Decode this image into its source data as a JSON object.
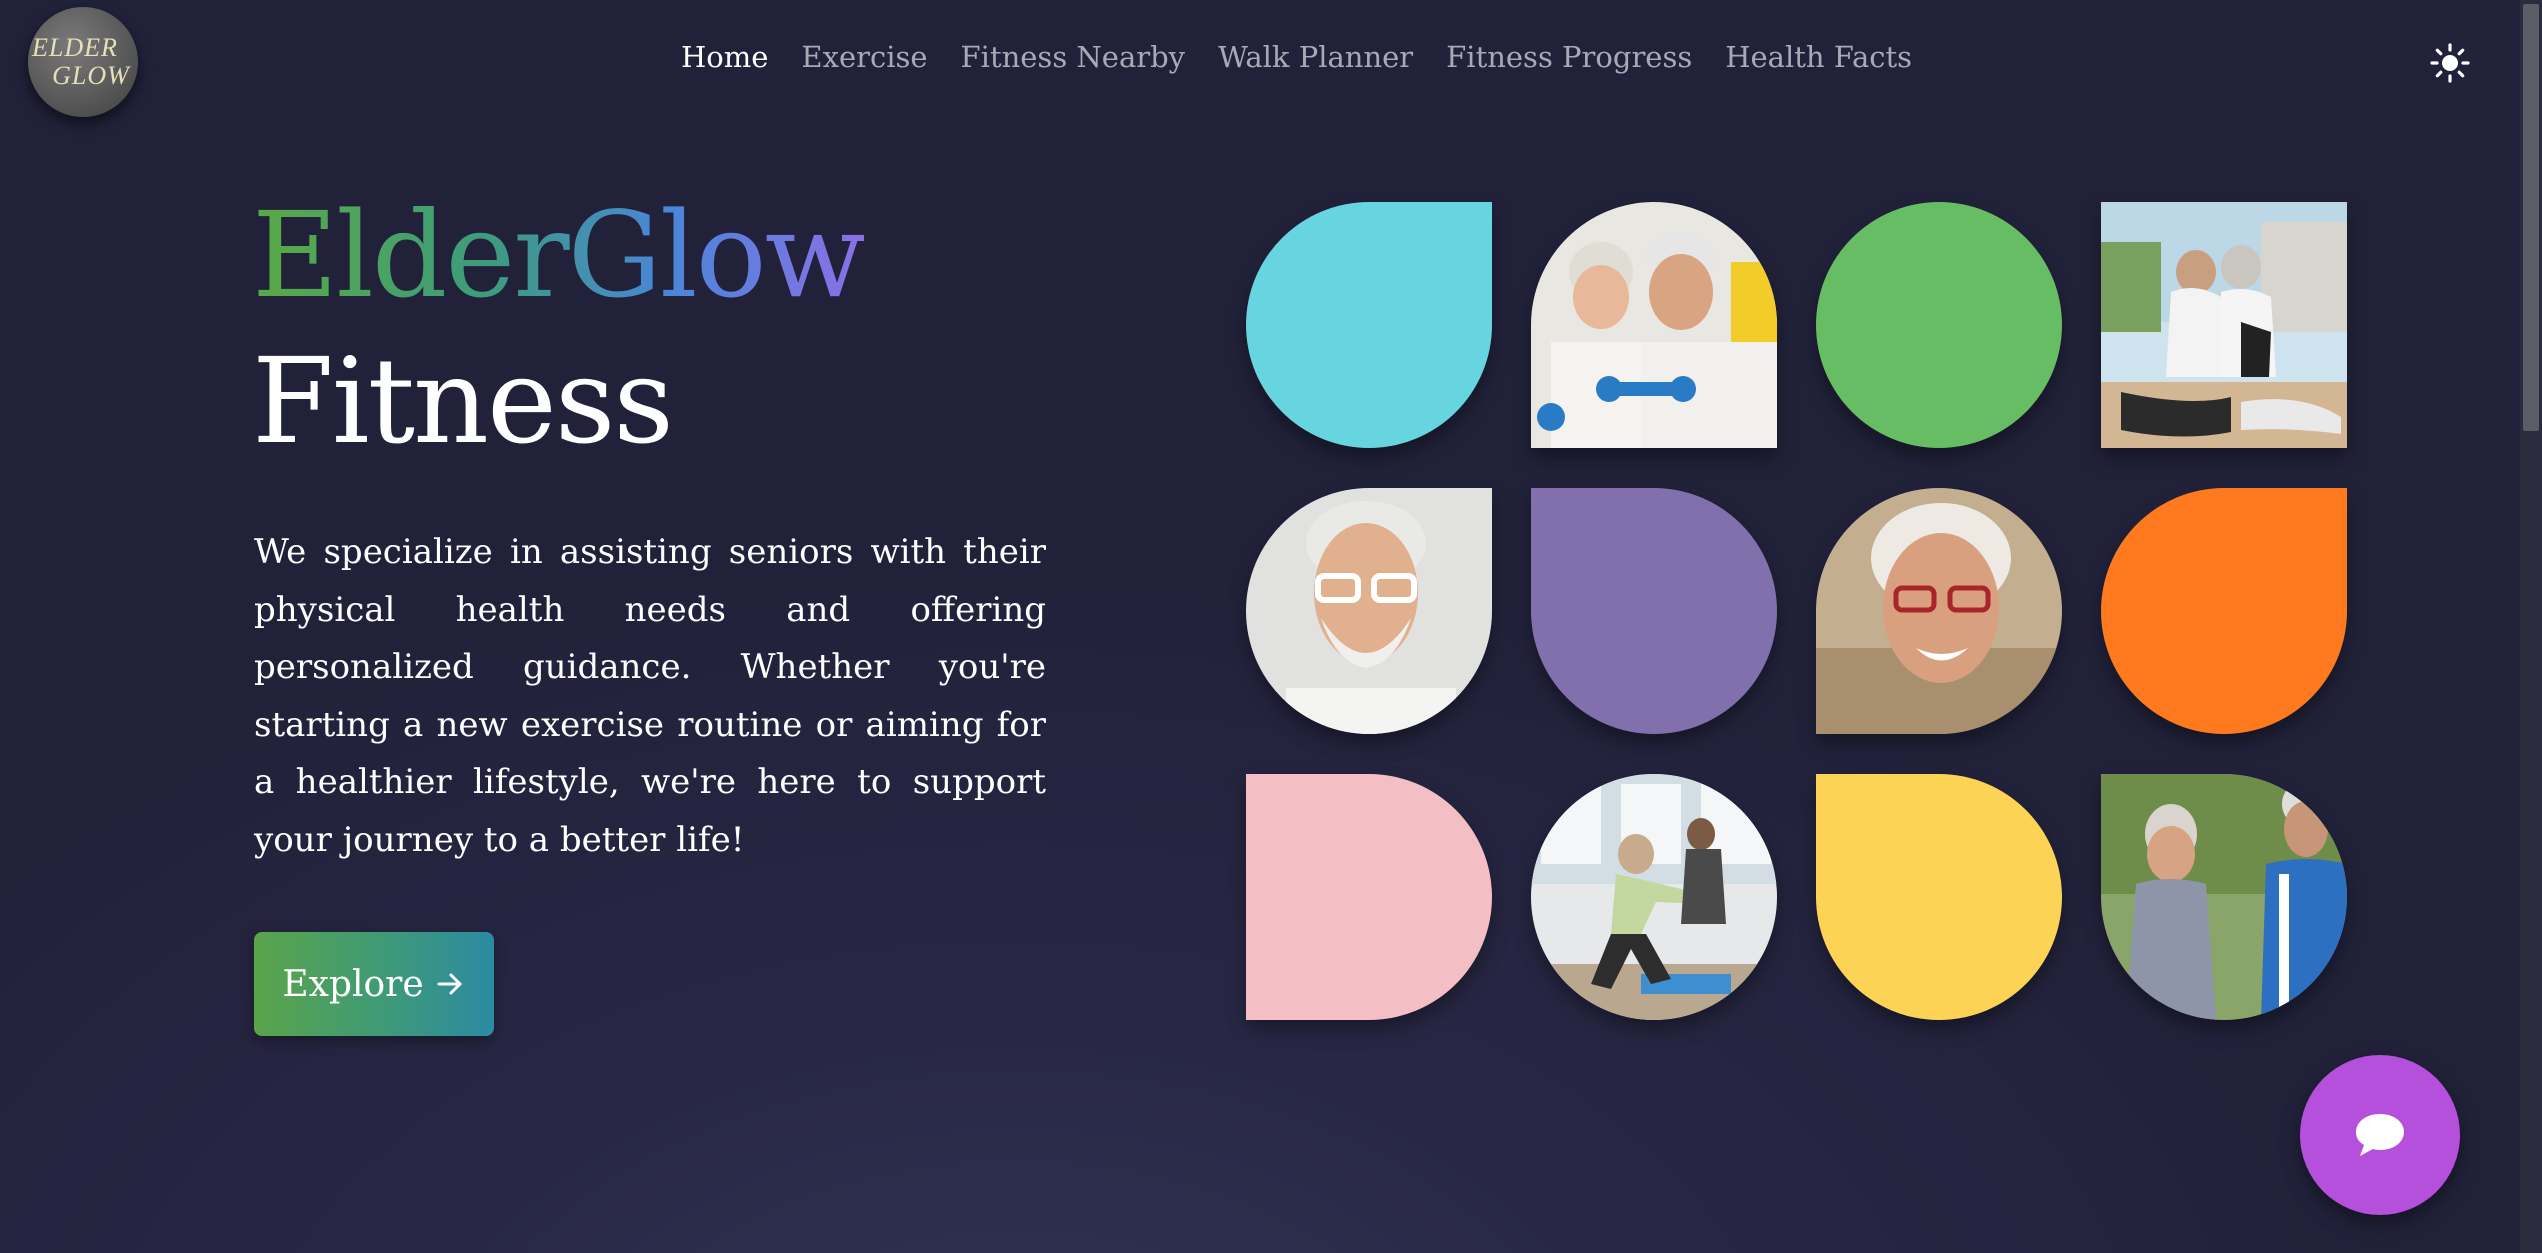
{
  "logo": {
    "line1": "ELDER",
    "line2": "GLOW"
  },
  "nav": {
    "items": [
      {
        "label": "Home",
        "active": true
      },
      {
        "label": "Exercise",
        "active": false
      },
      {
        "label": "Fitness Nearby",
        "active": false
      },
      {
        "label": "Walk Planner",
        "active": false
      },
      {
        "label": "Fitness Progress",
        "active": false
      },
      {
        "label": "Health Facts",
        "active": false
      }
    ]
  },
  "theme_toggle": {
    "icon": "sun-icon"
  },
  "hero": {
    "brand": "ElderGlow",
    "subtitle": "Fitness",
    "description": "We specialize in assisting seniors with their physical health needs and offering personalized guidance. Whether you're starting a new exercise routine or aiming for a healthier lifestyle, we're here to support your journey to a better life!",
    "cta_label": "Explore",
    "cta_icon": "arrow-right-icon"
  },
  "grid_tiles": [
    {
      "kind": "color",
      "color": "#66d5df",
      "shape": "drop-tr"
    },
    {
      "kind": "photo",
      "subject": "seniors-with-dumbbells",
      "shape": "arch"
    },
    {
      "kind": "color",
      "color": "#67bd63",
      "shape": "circle"
    },
    {
      "kind": "photo",
      "subject": "seniors-stretching-back-to-back",
      "shape": "square"
    },
    {
      "kind": "photo",
      "subject": "smiling-senior-man-glasses",
      "shape": "drop-tr"
    },
    {
      "kind": "color",
      "color": "#8270ad",
      "shape": "drop-tl"
    },
    {
      "kind": "photo",
      "subject": "laughing-senior-woman",
      "shape": "drop-bl"
    },
    {
      "kind": "color",
      "color": "#ff7a1f",
      "shape": "drop-tr"
    },
    {
      "kind": "color",
      "color": "#f4bec5",
      "shape": "d-shape"
    },
    {
      "kind": "photo",
      "subject": "senior-woman-exercise-class",
      "shape": "circle"
    },
    {
      "kind": "color",
      "color": "#fcd354",
      "shape": "drop-tl"
    },
    {
      "kind": "photo",
      "subject": "seniors-jogging-outdoors",
      "shape": "drop-tl"
    }
  ],
  "colors": {
    "background": "#262641",
    "brand_gradient": [
      "#5aa944",
      "#3d9c7c",
      "#4a86d8",
      "#8a70e6"
    ],
    "chat_button": "#b550dd",
    "nav_inactive": "#a9a9b6"
  },
  "chat": {
    "icon": "chat-bubble-icon"
  }
}
